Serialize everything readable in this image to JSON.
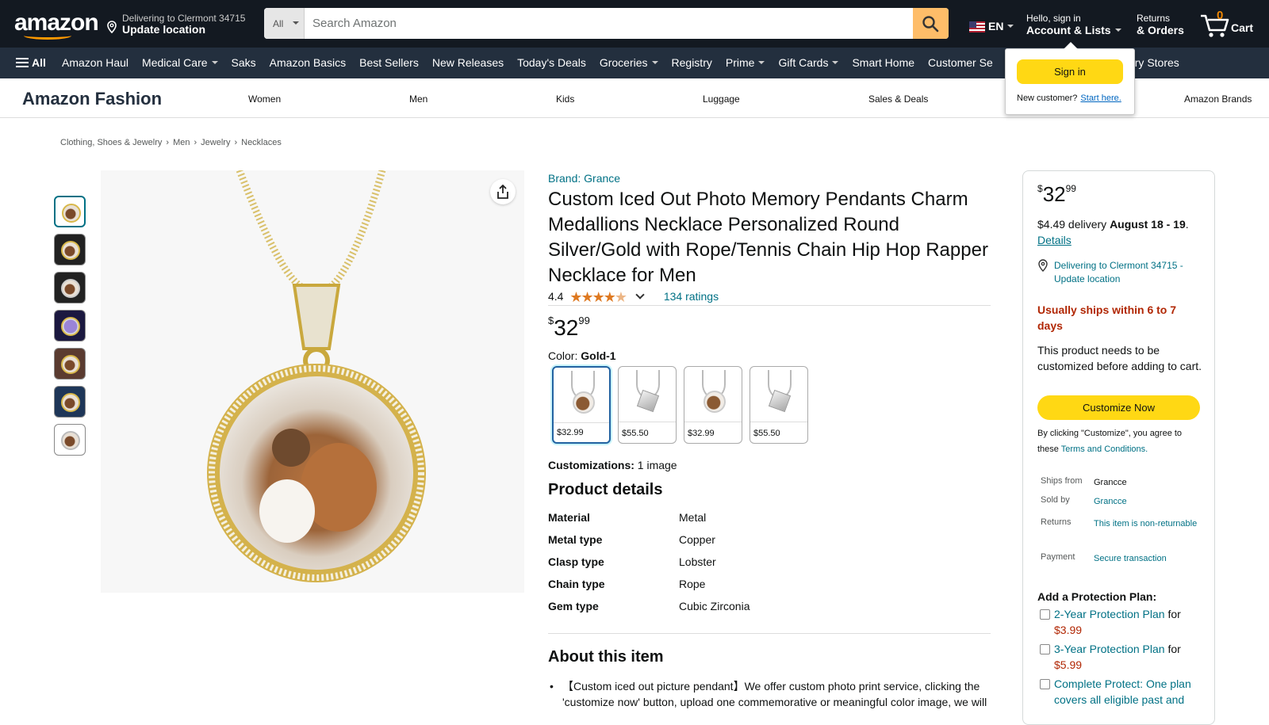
{
  "header": {
    "logo": "amazon",
    "deliver_line1": "Delivering to Clermont 34715",
    "deliver_line2": "Update location",
    "search_category": "All",
    "search_placeholder": "Search Amazon",
    "lang": "EN",
    "account_line1": "Hello, sign in",
    "account_line2": "Account & Lists",
    "returns_line1": "Returns",
    "returns_line2": "& Orders",
    "cart_count": "0",
    "cart_label": "Cart"
  },
  "subnav": {
    "all_label": "All",
    "items": [
      "Amazon Haul",
      "Medical Care",
      "Saks",
      "Amazon Basics",
      "Best Sellers",
      "New Releases",
      "Today's Deals",
      "Groceries",
      "Registry",
      "Prime",
      "Gift Cards",
      "Smart Home",
      "Customer Se",
      "ry",
      "Luxury Stores"
    ]
  },
  "popover": {
    "signin": "Sign in",
    "new_customer": "New customer?",
    "start_here": "Start here."
  },
  "fashion": {
    "brand": "Amazon Fashion",
    "links": [
      "Women",
      "Men",
      "Kids",
      "Luggage",
      "Sales & Deals",
      "Amazon Brands"
    ]
  },
  "breadcrumb": [
    "Clothing, Shoes & Jewelry",
    "Men",
    "Jewelry",
    "Necklaces"
  ],
  "product": {
    "brand": "Brand: Grance",
    "title": "Custom Iced Out Photo Memory Pendants Charm Medallions Necklace Personalized Round Silver/Gold with Rope/Tennis Chain Hip Hop Rapper Necklace for Men",
    "rating_value": "4.4",
    "stars_fraction": 0.88,
    "ratings_count": "134 ratings",
    "price_symbol": "$",
    "price_whole": "32",
    "price_fraction": "99",
    "color_label": "Color:",
    "color_value": "Gold-1",
    "swatches": [
      {
        "price": "$32.99",
        "kind": "round"
      },
      {
        "price": "$55.50",
        "kind": "cube"
      },
      {
        "price": "$32.99",
        "kind": "round"
      },
      {
        "price": "$55.50",
        "kind": "cube"
      }
    ],
    "customizations_label": "Customizations:",
    "customizations_value": "1 image",
    "details_heading": "Product details",
    "details": [
      {
        "k": "Material",
        "v": "Metal"
      },
      {
        "k": "Metal type",
        "v": "Copper"
      },
      {
        "k": "Clasp type",
        "v": "Lobster"
      },
      {
        "k": "Chain type",
        "v": "Rope"
      },
      {
        "k": "Gem type",
        "v": "Cubic Zirconia"
      }
    ],
    "about_heading": "About this item",
    "bullet1": "【Custom iced out picture pendant】We offer custom photo print service, clicking the 'customize now' button, upload one commemorative or meaningful color image, we will"
  },
  "buybox": {
    "price_symbol": "$",
    "price_whole": "32",
    "price_fraction": "99",
    "delivery_prefix": "$4.49 delivery",
    "delivery_dates": "August 18 - 19",
    "details_link": "Details",
    "location": "Delivering to Clermont 34715 - Update location",
    "ships_notice": "Usually ships within 6 to 7 days",
    "note": "This product needs to be customized before adding to cart.",
    "button": "Customize Now",
    "terms_prefix": "By clicking \"Customize\", you agree to these",
    "terms_link": "Terms and Conditions.",
    "info": [
      {
        "k": "Ships from",
        "v": "Grancce",
        "link": false
      },
      {
        "k": "Sold by",
        "v": "Grancce",
        "link": true
      },
      {
        "k": "Returns",
        "v": "This item is non-returnable",
        "link": true
      },
      {
        "k": "Payment",
        "v": "Secure transaction",
        "link": true
      }
    ],
    "protection_heading": "Add a Protection Plan:",
    "plans": [
      {
        "link": "2-Year Protection Plan",
        "mid": "for",
        "price": "$3.99"
      },
      {
        "link": "3-Year Protection Plan",
        "mid": "for",
        "price": "$5.99"
      },
      {
        "link": "Complete Protect: One plan covers all eligible past and",
        "mid": "",
        "price": ""
      }
    ]
  }
}
